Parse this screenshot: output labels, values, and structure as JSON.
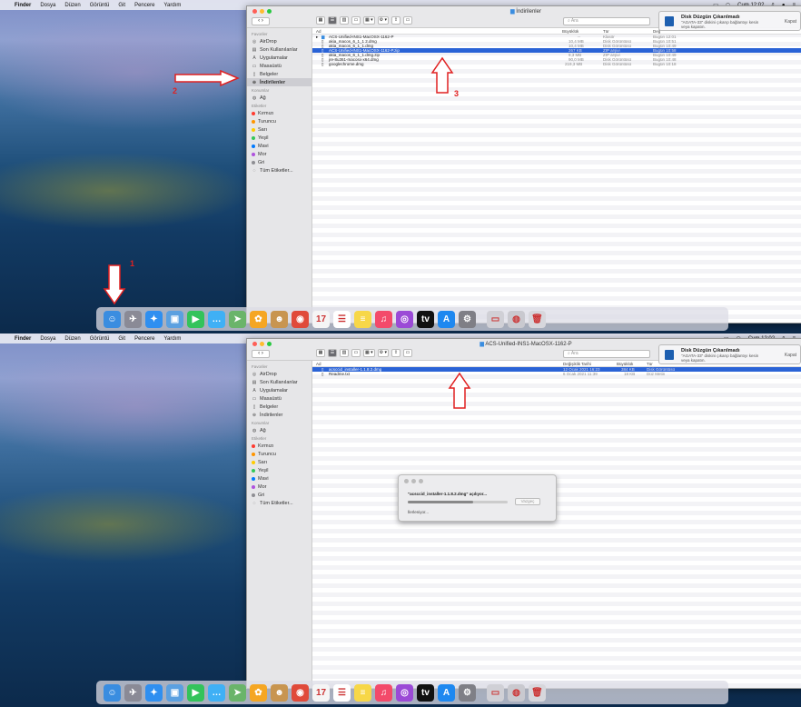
{
  "menubar": {
    "apple": "",
    "app": "Finder",
    "items": [
      "Dosya",
      "Düzen",
      "Görüntü",
      "Git",
      "Pencere",
      "Yardım"
    ],
    "clock": "Cum 12:02"
  },
  "notification": {
    "title": "Disk Düzgün Çıkarılmadı",
    "body": "\"AGATA-33\" diskini çıkarıp bağlantıyı kesin veya kapatın.",
    "close": "Kapat"
  },
  "sidebar": {
    "favorites_header": "Favoriler",
    "favorites": [
      "AirDrop",
      "Son Kullanılanlar",
      "Uygulamalar",
      "Masaüstü",
      "Belgeler",
      "İndirilenler"
    ],
    "locations_header": "Konumlar",
    "locations": [
      "Ağ"
    ],
    "tags_header": "Etiketler",
    "tags": [
      {
        "label": "Kırmızı",
        "color": "#ff3b30"
      },
      {
        "label": "Turuncu",
        "color": "#ff9500"
      },
      {
        "label": "Sarı",
        "color": "#ffcc00"
      },
      {
        "label": "Yeşil",
        "color": "#34c759"
      },
      {
        "label": "Mavi",
        "color": "#007aff"
      },
      {
        "label": "Mor",
        "color": "#af52de"
      },
      {
        "label": "Gri",
        "color": "#8e8e93"
      }
    ],
    "all_tags": "Tüm Etiketler..."
  },
  "search_placeholder": "Ara",
  "panel1": {
    "window_title": "İndirilenler",
    "columns": {
      "name": "Ad",
      "size": "Büyüklük",
      "kind": "Tür",
      "date": "Değ"
    },
    "files": [
      {
        "name": "ACS-Unified-INS1-MacOSX-1162-P",
        "size": "--",
        "kind": "Klasör",
        "date": "Bugün 12:01"
      },
      {
        "name": "akia_macos_6_1_1 2.dmg",
        "size": "10,4 MB",
        "kind": "Disk Görüntüsü",
        "date": "Bugün 10:51"
      },
      {
        "name": "akia_macos_6_1_1.dmg",
        "size": "10,4 MB",
        "kind": "Disk Görüntüsü",
        "date": "Bugün 10:49"
      },
      {
        "name": "ACS-Unified-INS1-MacOSX-1162-P.zip",
        "size": "267 KB",
        "kind": "ZIP arşivi",
        "date": "Bugün 10:58"
      },
      {
        "name": "akia_macos_6_1_1.dmg.zip",
        "size": "9,3 MB",
        "kind": "ZIP arşivi",
        "date": "Bugün 10:49"
      },
      {
        "name": "jre-8u361-macosx-x64.dmg",
        "size": "90,0 MB",
        "kind": "Disk Görüntüsü",
        "date": "Bugün 10:48"
      },
      {
        "name": "googlechrome.dmg",
        "size": "219,3 MB",
        "kind": "Disk Görüntüsü",
        "date": "Bugün 10:18"
      }
    ],
    "annotations": {
      "one": "1",
      "two": "2",
      "three": "3"
    }
  },
  "panel2": {
    "window_title": "ACS-Unified-INS1-MacOSX-1162-P",
    "columns": {
      "name": "Ad",
      "date": "Değişiklik Tarihi",
      "size": "Büyüklük",
      "kind": "Tür"
    },
    "files": [
      {
        "name": "acsccid_installer-1.1.8.2.dmg",
        "date": "12 Ocak 2021 16:23",
        "size": "384 KB",
        "kind": "Disk Görüntüsü"
      },
      {
        "name": "Readme.txt",
        "date": "6 Ocak 2021 11:39",
        "size": "18 KB",
        "kind": "Düz Metin"
      }
    ],
    "dialog": {
      "title": "\"acsccid_installer-1.1.8.2.dmg\" açılıyor...",
      "button": "Vazgeç",
      "status": "İlerleniyor...",
      "progress": 0.65
    }
  },
  "dock": {
    "icons": [
      {
        "name": "finder-icon",
        "color": "#3a8de0",
        "glyph": "☺"
      },
      {
        "name": "launchpad-icon",
        "color": "#8a8a96",
        "glyph": "✈"
      },
      {
        "name": "safari-icon",
        "color": "#2f8ff0",
        "glyph": "✦"
      },
      {
        "name": "preview-icon",
        "color": "#5ba0e0",
        "glyph": "▣"
      },
      {
        "name": "facetime-icon",
        "color": "#33c35b",
        "glyph": "▶"
      },
      {
        "name": "messages-icon",
        "color": "#3fb0f5",
        "glyph": "…"
      },
      {
        "name": "maps-icon",
        "color": "#6ab46a",
        "glyph": "➤"
      },
      {
        "name": "photos-icon",
        "color": "#f5a623",
        "glyph": "✿"
      },
      {
        "name": "contacts-icon",
        "color": "#c89550",
        "glyph": "☻"
      },
      {
        "name": "chrome-icon",
        "color": "#e04a3a",
        "glyph": "◉"
      },
      {
        "name": "calendar-icon",
        "color": "#f5f5f5",
        "glyph": "17"
      },
      {
        "name": "reminders-icon",
        "color": "#ffffff",
        "glyph": "☰"
      },
      {
        "name": "notes-icon",
        "color": "#f7d748",
        "glyph": "≡"
      },
      {
        "name": "music-icon",
        "color": "#f34a6a",
        "glyph": "♫"
      },
      {
        "name": "podcasts-icon",
        "color": "#9b4ad6",
        "glyph": "◎"
      },
      {
        "name": "tv-icon",
        "color": "#111111",
        "glyph": "tv"
      },
      {
        "name": "appstore-icon",
        "color": "#1e88f0",
        "glyph": "A"
      },
      {
        "name": "system-preferences-icon",
        "color": "#7f7f86",
        "glyph": "⚙"
      },
      {
        "name": "downloads-stack-icon",
        "color": "#d0d0d6",
        "glyph": "▭"
      },
      {
        "name": "disk-image-icon",
        "color": "#c9c9cf",
        "glyph": "◍"
      },
      {
        "name": "trash-icon",
        "color": "#d7d7dc",
        "glyph": "🗑"
      }
    ]
  }
}
